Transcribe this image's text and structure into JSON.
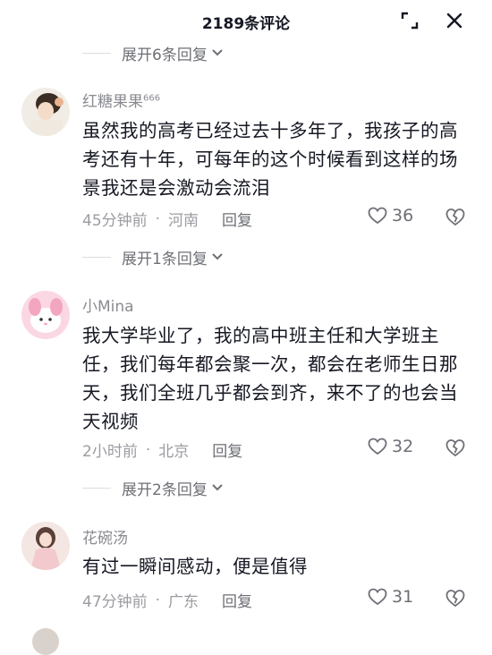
{
  "header": {
    "title": "2189条评论",
    "icons": [
      "expand-icon",
      "close-icon"
    ]
  },
  "comments": [
    {
      "expand_label": "展开6条回复",
      "username": "红糖果果",
      "username_suffix": "666",
      "text": "虽然我的高考已经过去十多年了，我孩子的高考还有十年，可每年的这个时候看到这样的场景我还是会激动会流泪",
      "time": "45分钟前",
      "location": "河南",
      "reply_label": "回复",
      "likes": "36",
      "sub_expand_label": "展开1条回复"
    },
    {
      "username": "小Mina",
      "text": "我大学毕业了，我的高中班主任和大学班主任，我们每年都会聚一次，都会在老师生日那天，我们全班几乎都会到齐，来不了的也会当天视频",
      "time": "2小时前",
      "location": "北京",
      "reply_label": "回复",
      "likes": "32",
      "sub_expand_label": "展开2条回复"
    },
    {
      "username": "花碗汤",
      "text": "有过一瞬间感动，便是值得",
      "time": "47分钟前",
      "location": "广东",
      "reply_label": "回复",
      "likes": "31"
    }
  ],
  "separator_dot": "·",
  "colors": {
    "text_primary": "#161823",
    "text_secondary": "#8a8b91",
    "background": "#ffffff"
  }
}
